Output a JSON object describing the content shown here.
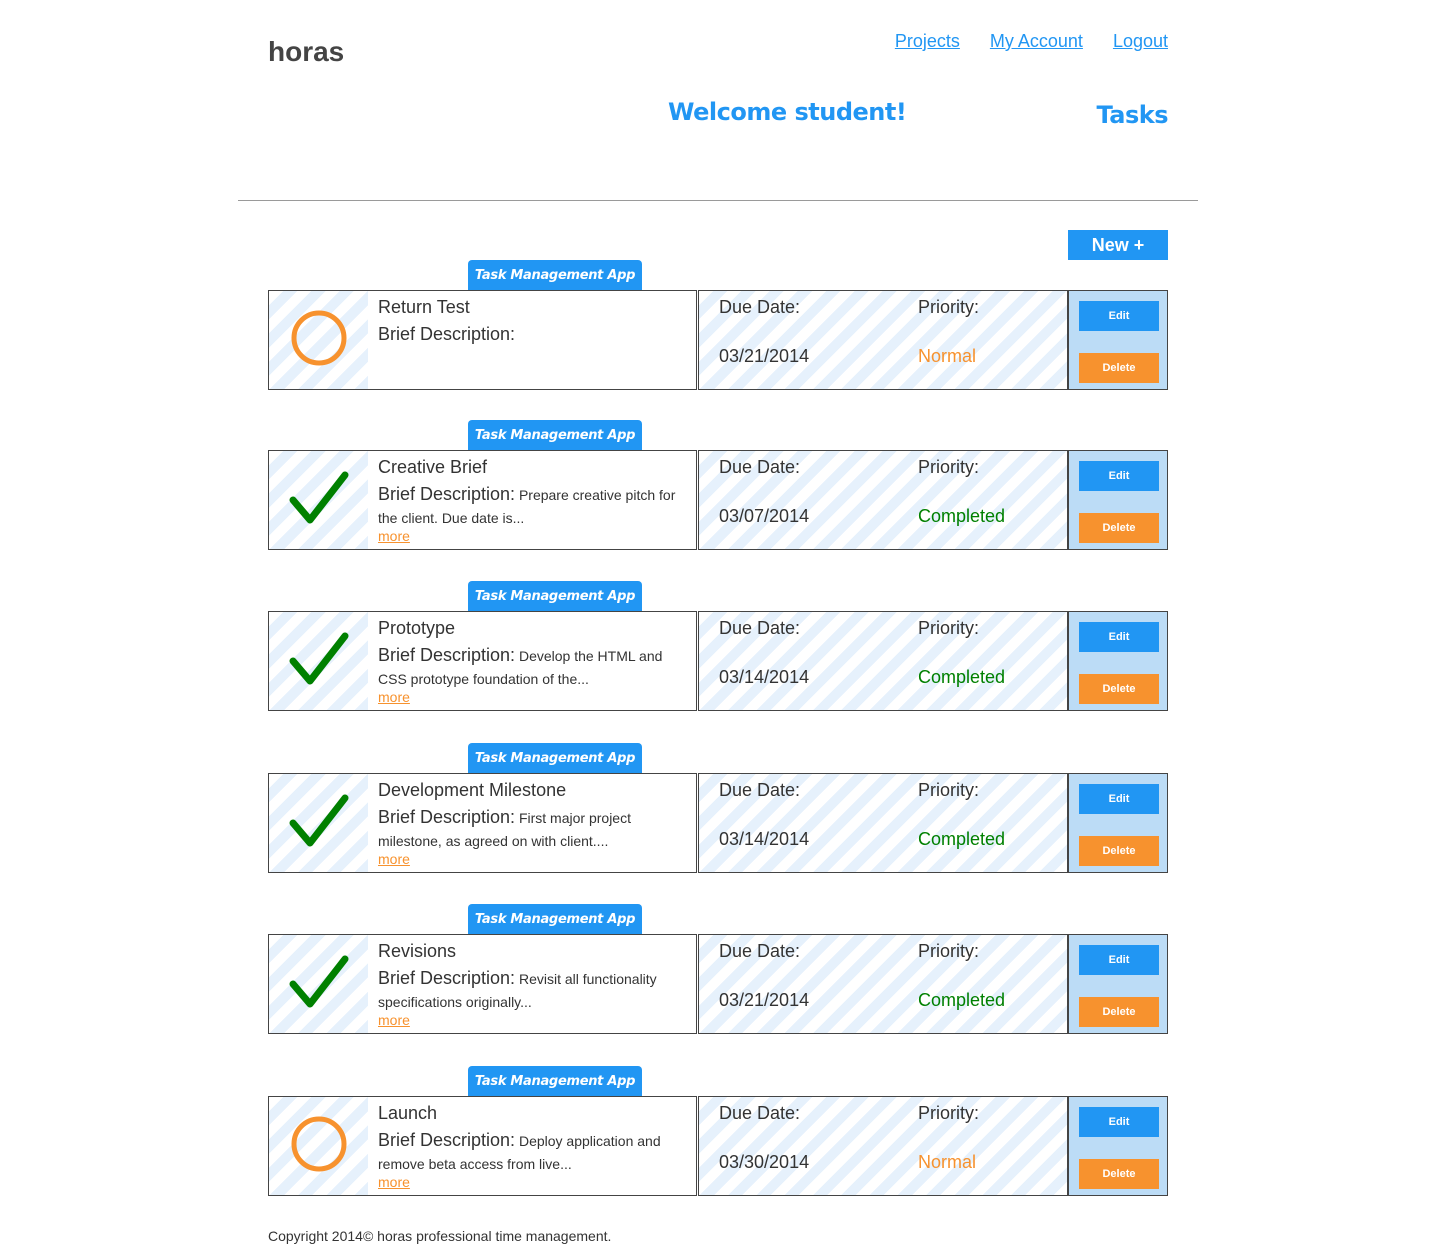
{
  "header": {
    "logo": "horas",
    "nav": [
      "Projects",
      "My Account",
      "Logout"
    ],
    "welcome": "Welcome student!",
    "page_title": "Tasks"
  },
  "new_button": "New +",
  "labels": {
    "due_date": "Due Date:",
    "priority": "Priority:",
    "brief_description": "Brief Description:",
    "more": "more",
    "edit": "Edit",
    "delete": "Delete"
  },
  "colors": {
    "accent": "#2196f3",
    "normal": "#f7922e",
    "completed": "#008000"
  },
  "tasks": [
    {
      "project": "Task Management App",
      "name": "Return Test",
      "description": "",
      "due": "03/21/2014",
      "priority": "Normal",
      "status_icon": "circle-icon"
    },
    {
      "project": "Task Management App",
      "name": "Creative Brief",
      "description": "Prepare creative pitch for the client. Due date is...",
      "due": "03/07/2014",
      "priority": "Completed",
      "status_icon": "checkmark-icon"
    },
    {
      "project": "Task Management App",
      "name": "Prototype",
      "description": "Develop the HTML and CSS prototype foundation of the...",
      "due": "03/14/2014",
      "priority": "Completed",
      "status_icon": "checkmark-icon"
    },
    {
      "project": "Task Management App",
      "name": "Development Milestone",
      "description": "First major project milestone, as agreed on with client....",
      "due": "03/14/2014",
      "priority": "Completed",
      "status_icon": "checkmark-icon"
    },
    {
      "project": "Task Management App",
      "name": "Revisions",
      "description": "Revisit all functionality specifications originally...",
      "due": "03/21/2014",
      "priority": "Completed",
      "status_icon": "checkmark-icon"
    },
    {
      "project": "Task Management App",
      "name": "Launch",
      "description": "Deploy application and remove beta access from live...",
      "due": "03/30/2014",
      "priority": "Normal",
      "status_icon": "circle-icon"
    }
  ],
  "footer": "Copyright 2014© horas professional time management."
}
